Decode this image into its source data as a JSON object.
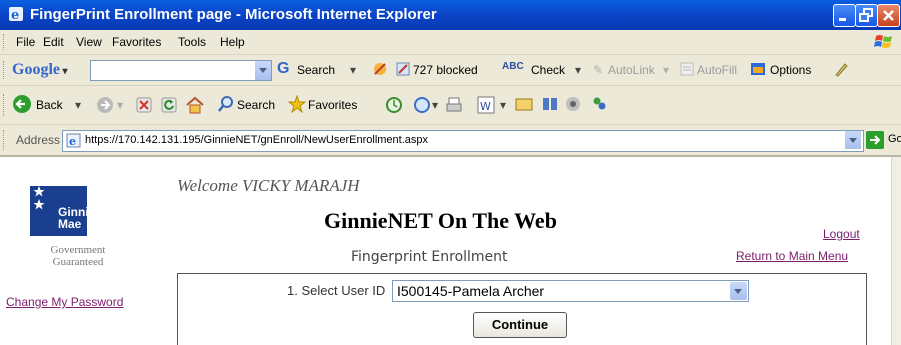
{
  "window": {
    "title": "FingerPrint Enrollment page - Microsoft Internet Explorer"
  },
  "menu": {
    "items": [
      "File",
      "Edit",
      "View",
      "Favorites",
      "Tools",
      "Help"
    ]
  },
  "google_toolbar": {
    "logo": "Google",
    "search_label": "Search",
    "blocked_label": "727 blocked",
    "check_label": "Check",
    "autolink_label": "AutoLink",
    "autofill_label": "AutoFill",
    "options_label": "Options"
  },
  "std_toolbar": {
    "back_label": "Back",
    "search_label": "Search",
    "favorites_label": "Favorites"
  },
  "address": {
    "label": "Address",
    "url": "https://170.142.131.195/GinnieNET/gnEnroll/NewUserEnrollment.aspx",
    "go_label": "Go"
  },
  "sidebar": {
    "logo_line1": "Ginnie",
    "logo_line2": "Mae",
    "logo_sub1": "Government",
    "logo_sub2": "Guaranteed",
    "change_password": "Change My Password"
  },
  "page": {
    "welcome": "Welcome VICKY MARAJH",
    "heading": "GinnieNET On The Web",
    "subheading": "Fingerprint Enrollment",
    "logout": "Logout",
    "return_menu": "Return to Main Menu",
    "select_label": "1. Select User ID",
    "select_value": "I500145-Pamela Archer",
    "continue_label": "Continue"
  },
  "colors": {
    "title_bar": "#0b46c9",
    "link": "#7a1d6a",
    "logo_blue": "#1b3f8f"
  }
}
